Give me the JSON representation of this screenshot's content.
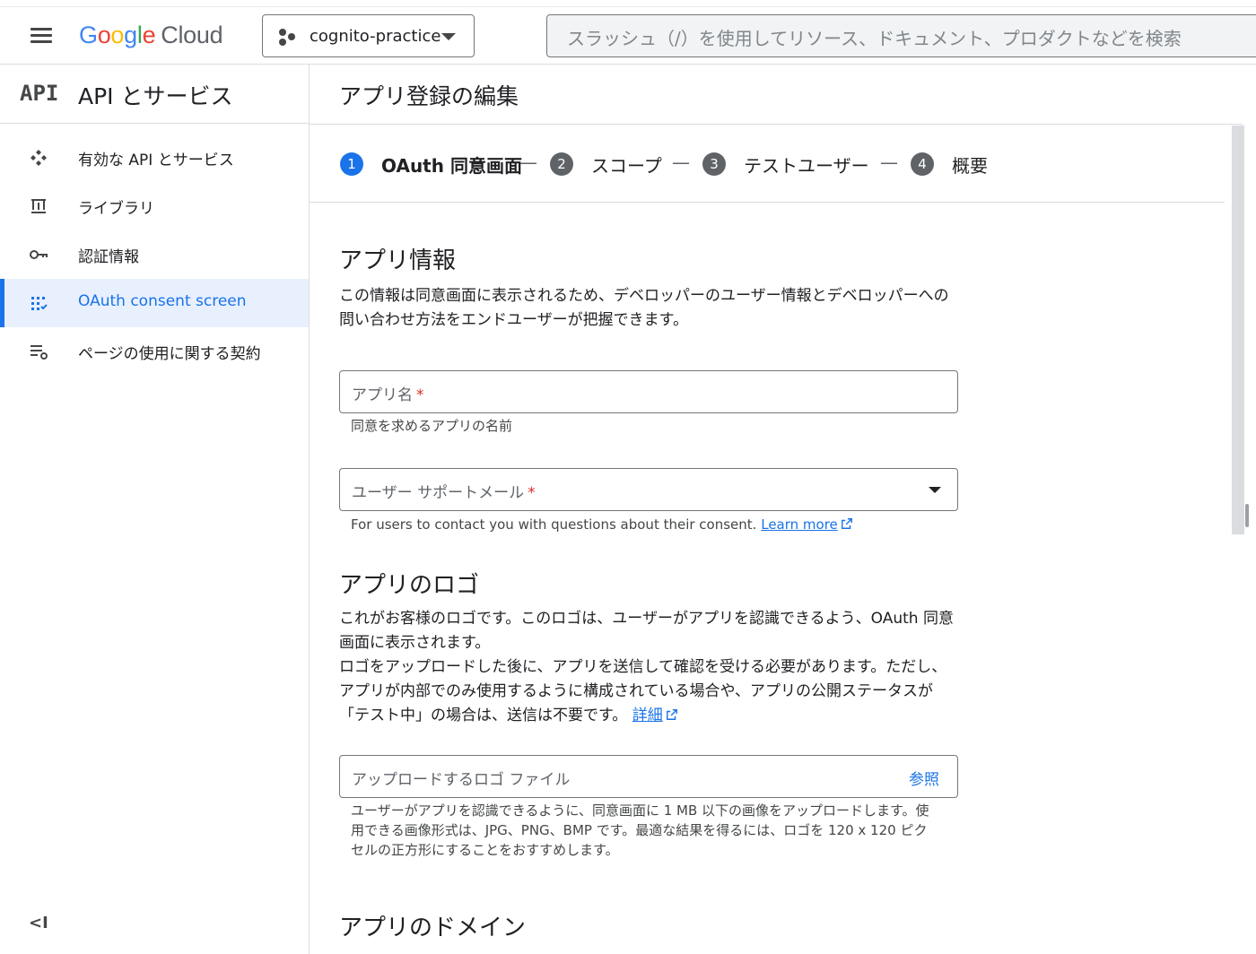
{
  "topbar": {
    "logo_letters": [
      "G",
      "o",
      "o",
      "g",
      "l",
      "e"
    ],
    "logo_product": "Cloud",
    "project_name": "cognito-practice",
    "search_placeholder": "スラッシュ（/）を使用してリソース、ドキュメント、プロダクトなどを検索"
  },
  "sidebar": {
    "api_logo": "API",
    "title": "API とサービス",
    "items": [
      {
        "label": "有効な API とサービス",
        "icon": "api-hub-icon",
        "active": false
      },
      {
        "label": "ライブラリ",
        "icon": "library-icon",
        "active": false
      },
      {
        "label": "認証情報",
        "icon": "key-icon",
        "active": false
      },
      {
        "label": "OAuth consent screen",
        "icon": "consent-grid-icon",
        "active": true
      },
      {
        "label": "ページの使用に関する契約",
        "icon": "settings-list-icon",
        "active": false
      }
    ],
    "collapse_glyph": "<I"
  },
  "main": {
    "page_title": "アプリ登録の編集",
    "steps": [
      {
        "num": "1",
        "label": "OAuth 同意画面",
        "active": true
      },
      {
        "num": "2",
        "label": "スコープ",
        "active": false
      },
      {
        "num": "3",
        "label": "テストユーザー",
        "active": false
      },
      {
        "num": "4",
        "label": "概要",
        "active": false
      }
    ],
    "step_separator": "—",
    "app_info": {
      "heading": "アプリ情報",
      "description": "この情報は同意画面に表示されるため、デベロッパーのユーザー情報とデベロッパーへの問い合わせ方法をエンドユーザーが把握できます。",
      "app_name_label": "アプリ名",
      "app_name_hint": "同意を求めるアプリの名前",
      "support_email_label": "ユーザー サポートメール",
      "support_email_hint": "For users to contact you with questions about their consent.",
      "learn_more": "Learn more",
      "required_mark": "*"
    },
    "logo_section": {
      "heading": "アプリのロゴ",
      "description_1": "これがお客様のロゴです。このロゴは、ユーザーがアプリを認識できるよう、OAuth 同意画面に表示されます。",
      "description_2": "ロゴをアップロードした後に、アプリを送信して確認を受ける必要があります。ただし、アプリが内部でのみ使用するように構成されている場合や、アプリの公開ステータスが「テスト中」の場合は、送信は不要です。",
      "details_link": "詳細",
      "file_placeholder": "アップロードするロゴ ファイル",
      "browse_label": "参照",
      "file_hint": "ユーザーがアプリを認識できるように、同意画面に 1 MB 以下の画像をアップロードします。使用できる画像形式は、JPG、PNG、BMP です。最適な結果を得るには、ロゴを 120 x 120 ピクセルの正方形にすることをおすすめします。"
    },
    "domain_section": {
      "heading": "アプリのドメイン"
    }
  },
  "colors": {
    "accent": "#1a73e8",
    "active_bg": "#e8f0fe",
    "required": "#d93025",
    "step_inactive": "#5f6368"
  }
}
